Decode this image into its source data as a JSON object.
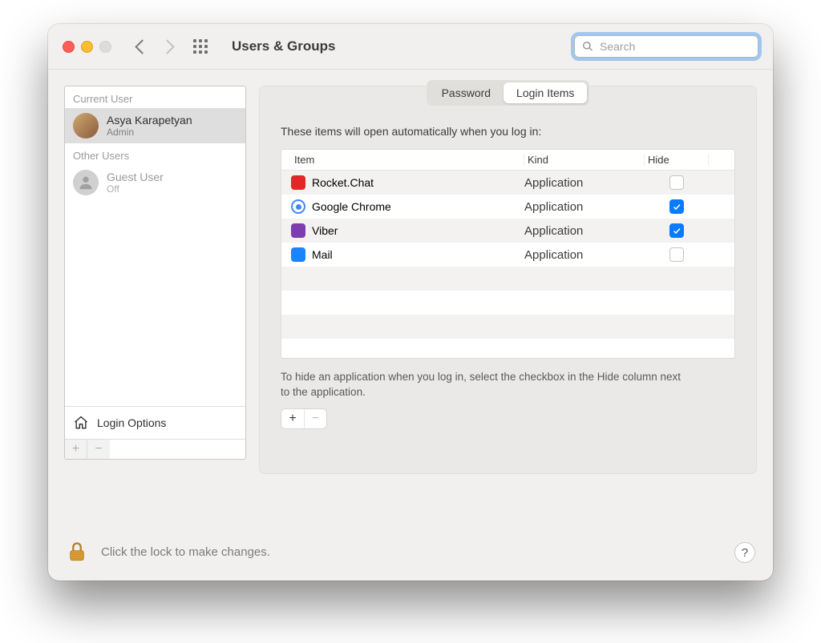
{
  "header": {
    "title": "Users & Groups",
    "search_placeholder": "Search"
  },
  "sidebar": {
    "current_user_label": "Current User",
    "other_users_label": "Other Users",
    "current": {
      "name": "Asya Karapetyan",
      "role": "Admin"
    },
    "guest": {
      "name": "Guest User",
      "status": "Off"
    },
    "login_options_label": "Login Options"
  },
  "tabs": {
    "password": "Password",
    "login_items": "Login Items",
    "active": "login_items"
  },
  "main": {
    "lead": "These items will open automatically when you log in:",
    "columns": {
      "item": "Item",
      "kind": "Kind",
      "hide": "Hide"
    },
    "rows": [
      {
        "name": "Rocket.Chat",
        "kind": "Application",
        "hide": false,
        "icon": "rocket"
      },
      {
        "name": "Google Chrome",
        "kind": "Application",
        "hide": true,
        "icon": "chrome"
      },
      {
        "name": "Viber",
        "kind": "Application",
        "hide": true,
        "icon": "viber"
      },
      {
        "name": "Mail",
        "kind": "Application",
        "hide": false,
        "icon": "mail"
      }
    ],
    "hint": "To hide an application when you log in, select the checkbox in the Hide column next to the application."
  },
  "footer": {
    "lock_text": "Click the lock to make changes.",
    "help_label": "?"
  }
}
